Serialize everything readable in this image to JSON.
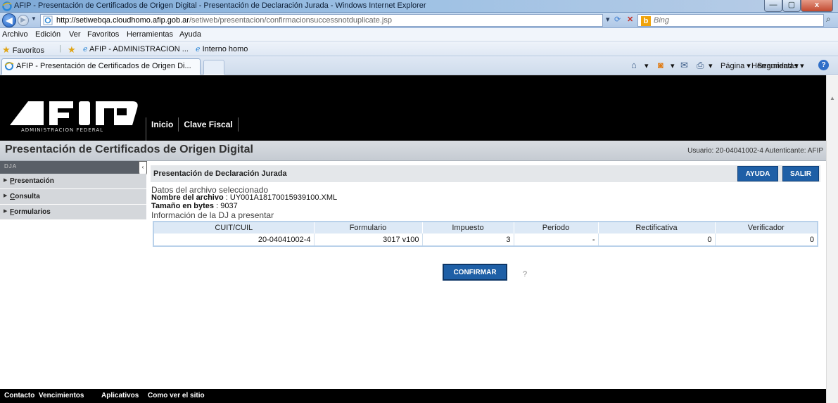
{
  "window": {
    "title": "AFIP - Presentación de Certificados de Origen Digital - Presentación de Declaración Jurada - Windows Internet Explorer",
    "minimize": "—",
    "maximize": "▢",
    "close": "x"
  },
  "address": {
    "url_host": "http://setiwebqa.cloudhomo.afip.gob.ar",
    "url_path": "/setiweb/presentacion/confirmacionsuccessnotduplicate.jsp",
    "search_placeholder": "Bing"
  },
  "menu": [
    "Archivo",
    "Edición",
    "Ver",
    "Favoritos",
    "Herramientas",
    "Ayuda"
  ],
  "favorites": {
    "label": "Favoritos",
    "items": [
      "AFIP - ADMINISTRACION ...",
      "Interno homo"
    ]
  },
  "tab": {
    "title": "AFIP - Presentación de Certificados de Origen Di..."
  },
  "commands": {
    "page": "Página ▾",
    "security": "Seguridad ▾",
    "tools": "Herramientas ▾"
  },
  "site": {
    "logo_caption": "ADMINISTRACION FEDERAL",
    "nav": [
      "Inicio",
      "Clave Fiscal"
    ],
    "page_title": "Presentación de Certificados de Origen Digital",
    "user_info": "Usuario: 20-04041002-4 Autenticante: AFIP"
  },
  "sidebar": {
    "header": "DJA",
    "items": [
      "Presentación",
      "Consulta",
      "Formularios"
    ]
  },
  "panel": {
    "title": "Presentación de Declaración Jurada",
    "help_button": "AYUDA",
    "exit_button": "SALIR"
  },
  "file_info": {
    "section_label": "Datos del archivo seleccionado",
    "name_label": "Nombre del archivo",
    "name_value": ": UY001A18170015939100.XML",
    "size_label": "Tamaño en bytes",
    "size_value": ": 9037"
  },
  "dj_info": {
    "section_label": "Información de la DJ a presentar",
    "columns": [
      "CUIT/CUIL",
      "Formulario",
      "Impuesto",
      "Período",
      "Rectificativa",
      "Verificador"
    ],
    "row": [
      "20-04041002-4",
      "3017 v100",
      "3",
      "-",
      "0",
      "0"
    ]
  },
  "actions": {
    "confirm_button": "CONFIRMAR",
    "help_mark": "?"
  },
  "footer": [
    "Contacto",
    "Vencimientos",
    "Aplicativos",
    "Como ver el sitio"
  ]
}
